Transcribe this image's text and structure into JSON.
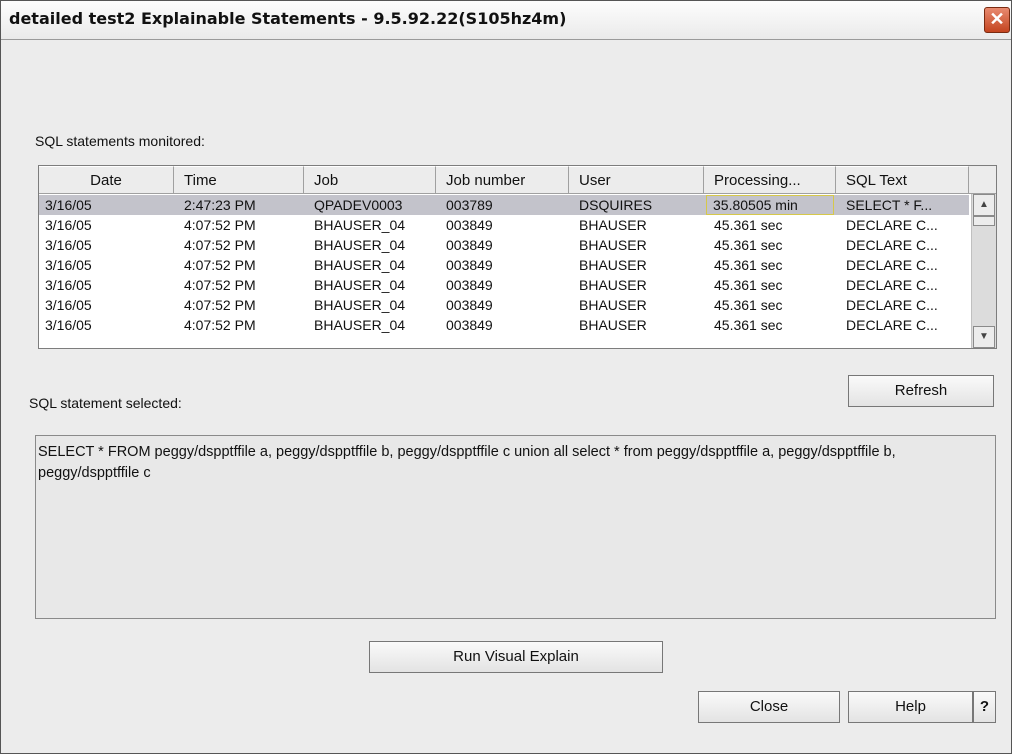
{
  "window": {
    "title": "detailed test2 Explainable Statements - 9.5.92.22(S105hz4m)",
    "close_glyph": "✕"
  },
  "monitored_label": "SQL statements monitored:",
  "table": {
    "columns": [
      "Date",
      "Time",
      "Job",
      "Job number",
      "User",
      "Processing...",
      "SQL Text"
    ],
    "rows": [
      [
        "3/16/05",
        "2:47:23 PM",
        "QPADEV0003",
        "003789",
        "DSQUIRES",
        "35.80505 min",
        "SELECT * F..."
      ],
      [
        "3/16/05",
        "4:07:52 PM",
        "BHAUSER_04",
        "003849",
        "BHAUSER",
        "45.361 sec",
        "DECLARE C..."
      ],
      [
        "3/16/05",
        "4:07:52 PM",
        "BHAUSER_04",
        "003849",
        "BHAUSER",
        "45.361 sec",
        "DECLARE C..."
      ],
      [
        "3/16/05",
        "4:07:52 PM",
        "BHAUSER_04",
        "003849",
        "BHAUSER",
        "45.361 sec",
        "DECLARE C..."
      ],
      [
        "3/16/05",
        "4:07:52 PM",
        "BHAUSER_04",
        "003849",
        "BHAUSER",
        "45.361 sec",
        "DECLARE C..."
      ],
      [
        "3/16/05",
        "4:07:52 PM",
        "BHAUSER_04",
        "003849",
        "BHAUSER",
        "45.361 sec",
        "DECLARE C..."
      ],
      [
        "3/16/05",
        "4:07:52 PM",
        "BHAUSER_04",
        "003849",
        "BHAUSER",
        "45.361 sec",
        "DECLARE C..."
      ]
    ]
  },
  "selected_label": "SQL statement selected:",
  "selected_sql": "SELECT * FROM peggy/dspptffile a, peggy/dspptffile b, peggy/dspptffile c union all select * from peggy/dspptffile a, peggy/dspptffile b, peggy/dspptffile c",
  "buttons": {
    "refresh": "Refresh",
    "run_visual_explain": "Run Visual Explain",
    "close": "Close",
    "help": "Help",
    "whats_this": "?"
  },
  "scrollbar": {
    "up_arrow": "▲",
    "down_arrow": "▼"
  },
  "colors": {
    "selected_row": "#c3c3cb",
    "focus_border": "#d6c84a",
    "close_button": "#c4441f"
  }
}
